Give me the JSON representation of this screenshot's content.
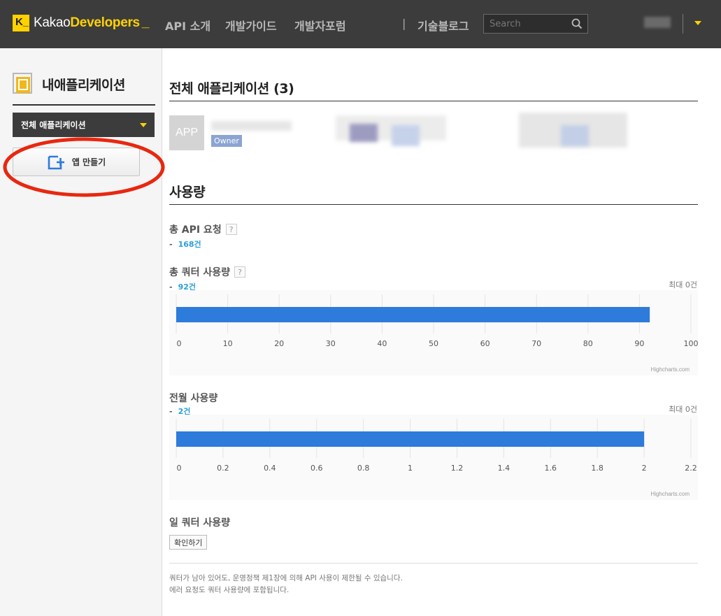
{
  "header": {
    "logo_prefix": "Kakao",
    "logo_brand": "Developers",
    "logo_suffix": "_",
    "logo_mark": "K_",
    "nav": [
      {
        "label": "API 소개"
      },
      {
        "label": "개발가이드"
      },
      {
        "label": "개발자포럼"
      },
      {
        "label": "기술블로그"
      }
    ],
    "separator": "|",
    "search_placeholder": "Search",
    "icons": {
      "search": "search-icon",
      "user_menu": "caret-down-icon"
    }
  },
  "sidebar": {
    "title": "내애플리케이션",
    "select_label": "전체 애플리케이션",
    "create_button": "앱 만들기",
    "icons": {
      "title": "app-logo-icon",
      "create": "plus-square-icon"
    },
    "colors": {
      "highlight_ellipse": "#e8280f",
      "select_caret": "#ffd200"
    }
  },
  "main": {
    "apps_title": "전체 애플리케이션 (3)",
    "app_tile_label": "APP",
    "owner_badge": "Owner",
    "usage_title": "사용량",
    "total_api": {
      "label": "총 API 요청",
      "dash": "-",
      "value": "168건"
    },
    "total_quota": {
      "label": "총 쿼터 사용량",
      "dash": "-",
      "value": "92건",
      "max": "최대 0건"
    },
    "last_month": {
      "label": "전월 사용량",
      "dash": "-",
      "value": "2건",
      "max": "최대 0건"
    },
    "daily_quota": {
      "label": "일 쿼터 사용량",
      "button": "확인하기"
    },
    "help_glyph": "?",
    "notes": [
      "쿼터가 남아 있어도, 운영정책 제1장에 의해 API 사용이 제한될 수 있습니다.",
      "에러 요청도 쿼터 사용량에 포함됩니다."
    ],
    "credit": "Highcharts.com"
  },
  "chart_data": [
    {
      "type": "bar",
      "orientation": "horizontal",
      "values": [
        92
      ],
      "xlim": [
        0,
        100
      ],
      "ticks": [
        "0",
        "10",
        "20",
        "30",
        "40",
        "50",
        "60",
        "70",
        "80",
        "90",
        "100"
      ],
      "tick_values": [
        0,
        10,
        20,
        30,
        40,
        50,
        60,
        70,
        80,
        90,
        100
      ],
      "color": "#2d7bdb",
      "grid": true
    },
    {
      "type": "bar",
      "orientation": "horizontal",
      "values": [
        2
      ],
      "xlim": [
        0,
        2.2
      ],
      "ticks": [
        "0",
        "0.2",
        "0.4",
        "0.6",
        "0.8",
        "1",
        "1.2",
        "1.4",
        "1.6",
        "1.8",
        "2",
        "2.2"
      ],
      "tick_values": [
        0,
        0.2,
        0.4,
        0.6,
        0.8,
        1,
        1.2,
        1.4,
        1.6,
        1.8,
        2,
        2.2
      ],
      "color": "#2d7bdb",
      "grid": true
    }
  ]
}
